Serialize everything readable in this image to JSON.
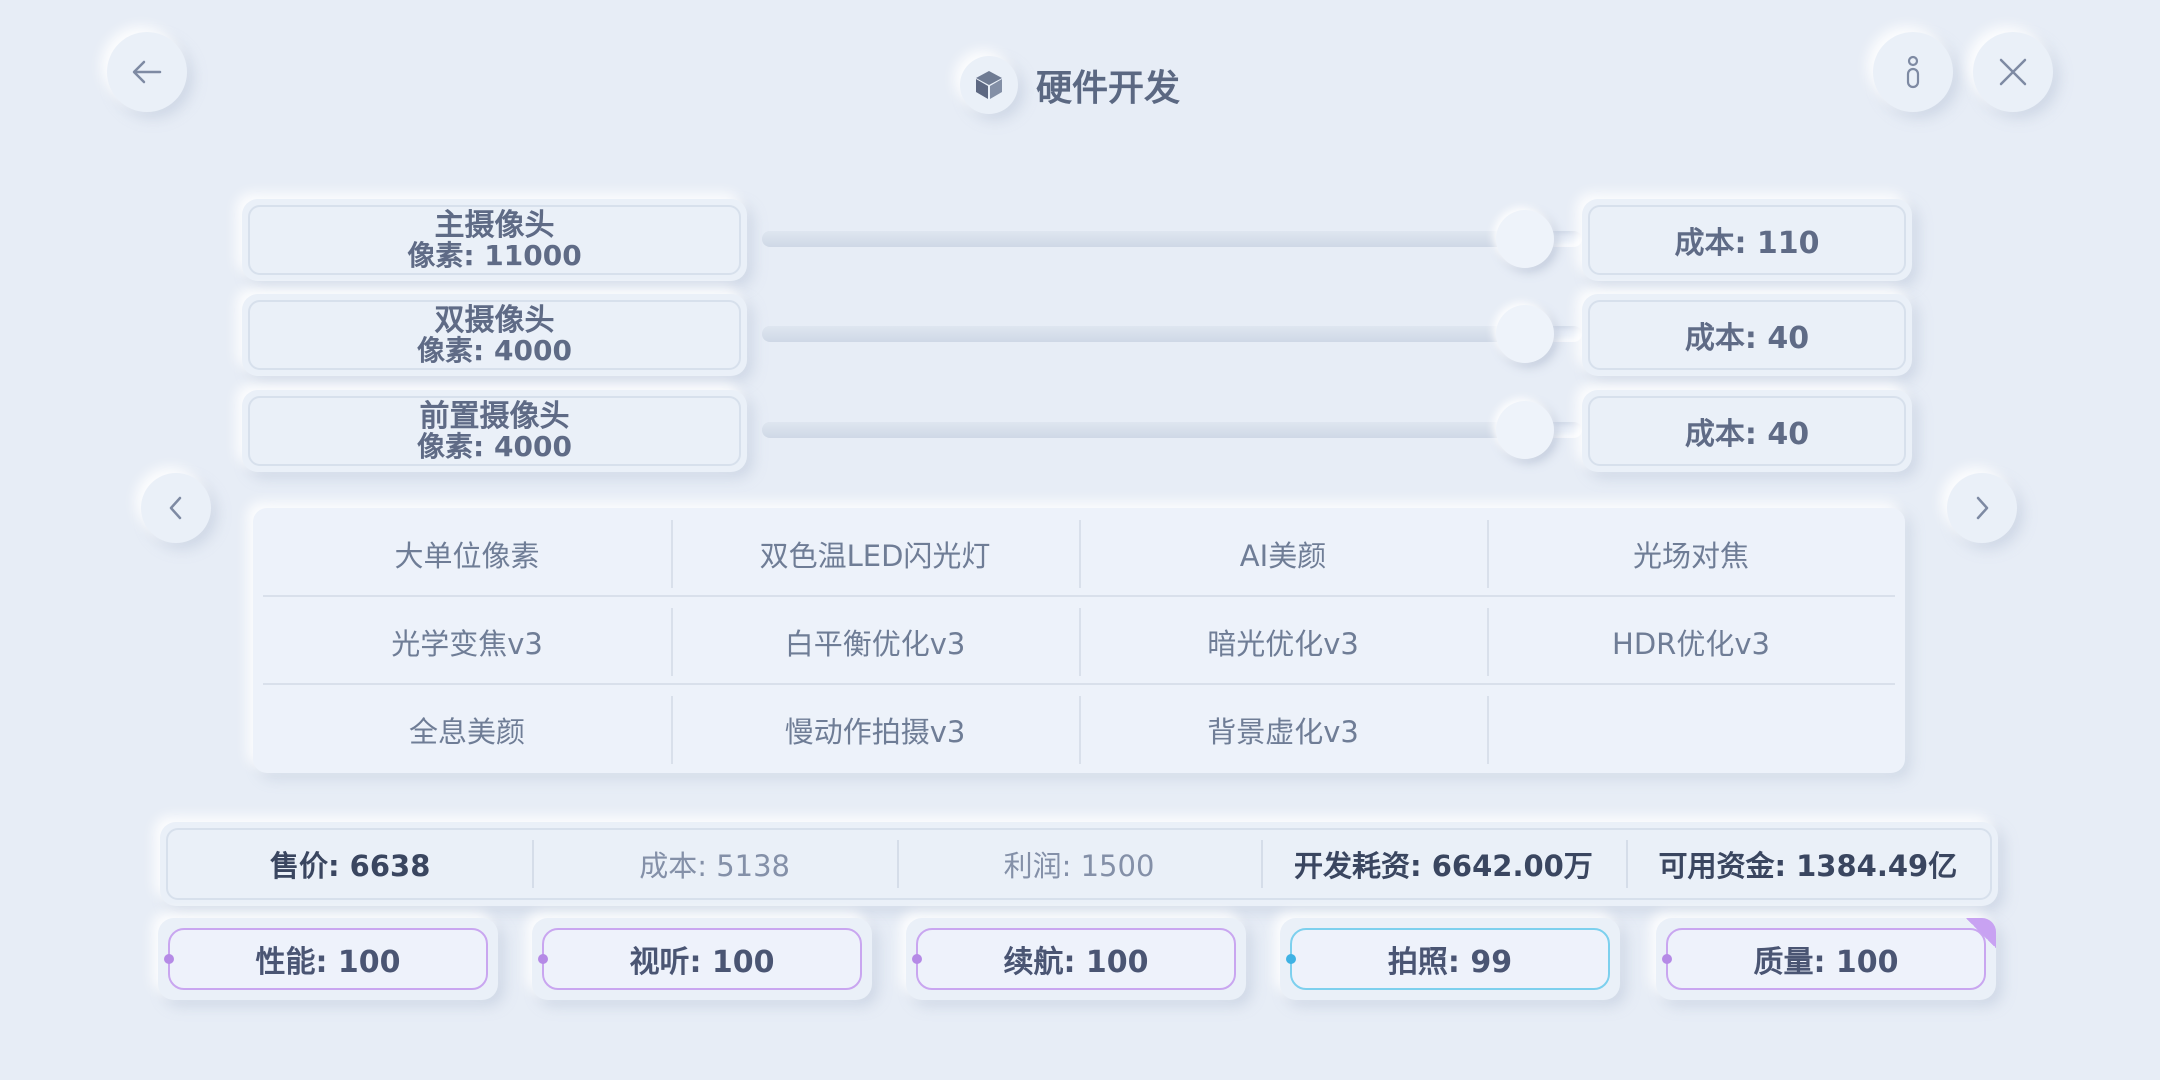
{
  "header": {
    "title": "硬件开发",
    "back_icon": "arrow-left-icon",
    "info_icon": "info-icon",
    "close_icon": "close-icon",
    "title_icon": "cube-icon"
  },
  "cameras": [
    {
      "name": "主摄像头",
      "pixels": "像素: 11000",
      "cost": "成本: 110",
      "level": 0.93
    },
    {
      "name": "双摄像头",
      "pixels": "像素: 4000",
      "cost": "成本: 40",
      "level": 0.93
    },
    {
      "name": "前置摄像头",
      "pixels": "像素: 4000",
      "cost": "成本: 40",
      "level": 0.93
    }
  ],
  "nav": {
    "prev_icon": "chevron-left-icon",
    "next_icon": "chevron-right-icon"
  },
  "features": {
    "rows": [
      [
        "大单位像素",
        "双色温LED闪光灯",
        "AI美颜",
        "光场对焦"
      ],
      [
        "光学变焦v3",
        "白平衡优化v3",
        "暗光优化v3",
        "HDR优化v3"
      ],
      [
        "全息美颜",
        "慢动作拍摄v3",
        "背景虚化v3",
        ""
      ]
    ]
  },
  "stats": {
    "price": "售价: 6638",
    "cost": "成本: 5138",
    "profit": "利润: 1500",
    "dev_cost": "开发耗资: 6642.00万",
    "funds": "可用资金: 1384.49亿"
  },
  "ratings": [
    {
      "label": "性能: 100",
      "accent": "#b58ae6"
    },
    {
      "label": "视听: 100",
      "accent": "#b58ae6"
    },
    {
      "label": "续航: 100",
      "accent": "#b58ae6"
    },
    {
      "label": "拍照: 99",
      "accent": "#3fb2e4"
    },
    {
      "label": "质量: 100",
      "accent": "#b58ae6"
    }
  ]
}
